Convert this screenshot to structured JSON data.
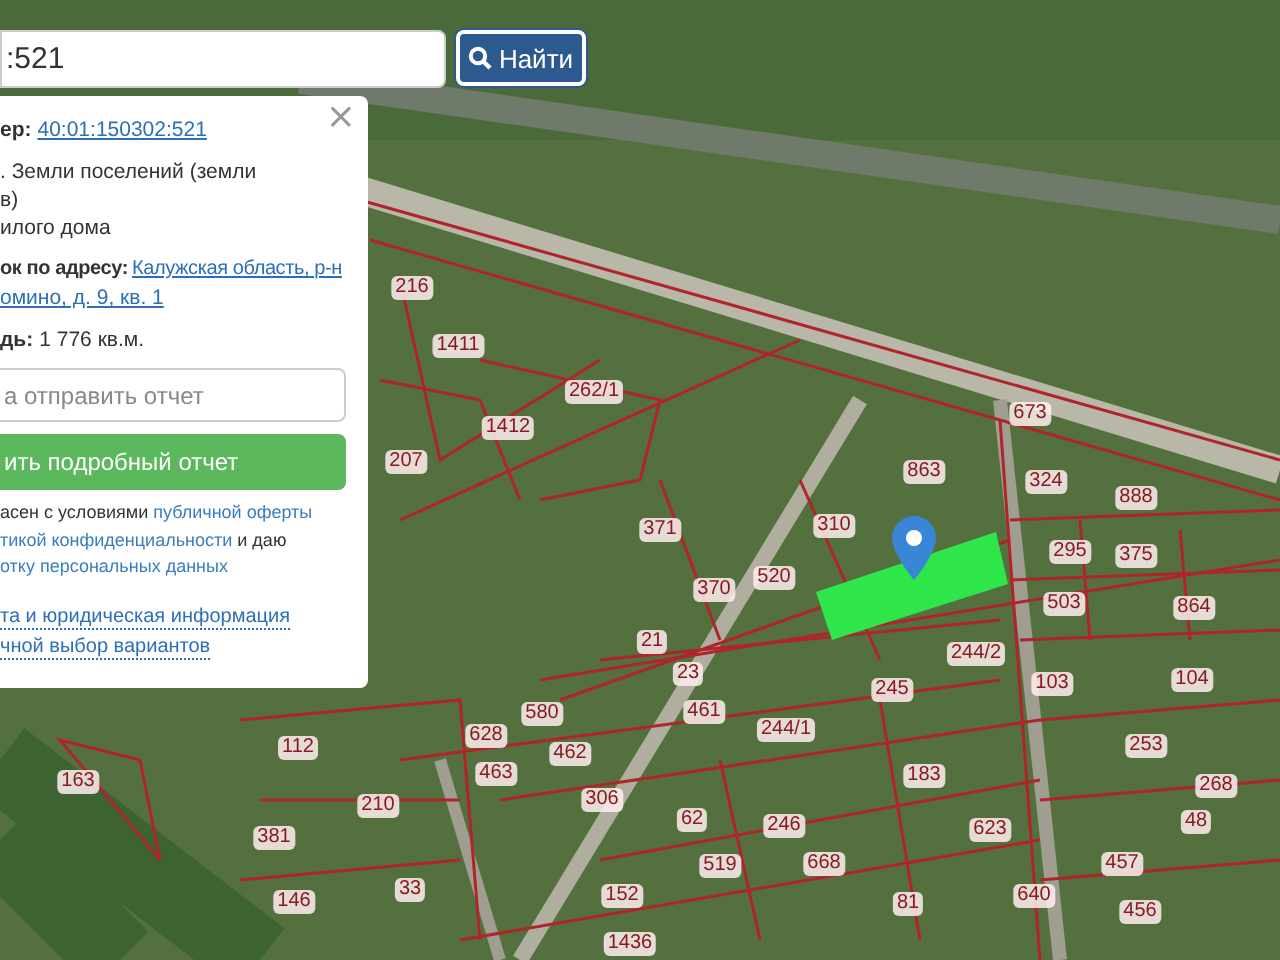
{
  "search": {
    "value": ":521",
    "button": "Найти"
  },
  "info_panel": {
    "close": "×",
    "cadastral": {
      "label": "ер:",
      "value": "40:01:150302:521"
    },
    "category_lines": [
      ". Земли поселений (земли",
      "в)",
      "илого дома"
    ],
    "address": {
      "label": "ок по адресу:",
      "lines": [
        "Калужская область, р-н",
        "омино, д. 9, кв. 1"
      ]
    },
    "area": {
      "label": "дь:",
      "value": "1 776 кв.м."
    },
    "email_field": {
      "placeholder": "а отправить отчет"
    },
    "report_button": "ить подробный отчет",
    "consent_lines": [
      [
        {
          "text": "асен с условиями ",
          "link": false
        },
        {
          "text": "публичной оферты",
          "link": true
        }
      ],
      [
        {
          "text": "тикой конфиденциальности",
          "link": true
        },
        {
          "text": " и даю",
          "link": false
        }
      ],
      [
        {
          "text": "отку персональных данных",
          "link": true
        }
      ]
    ],
    "footer_links": [
      "та и юридическая информация",
      "чной выбор вариантов"
    ]
  },
  "map": {
    "parcels": [
      {
        "number": "216"
      },
      {
        "number": "1411"
      },
      {
        "number": "262/1"
      },
      {
        "number": "1412"
      },
      {
        "number": "207"
      },
      {
        "number": "371"
      },
      {
        "number": "310"
      },
      {
        "number": "863"
      },
      {
        "number": "673"
      },
      {
        "number": "324"
      },
      {
        "number": "888"
      },
      {
        "number": "295"
      },
      {
        "number": "375"
      },
      {
        "number": "503"
      },
      {
        "number": "864"
      },
      {
        "number": "370"
      },
      {
        "number": "520"
      },
      {
        "number": "21"
      },
      {
        "number": "23"
      },
      {
        "number": "245"
      },
      {
        "number": "244/2"
      },
      {
        "number": "103"
      },
      {
        "number": "104"
      },
      {
        "number": "461"
      },
      {
        "number": "244/1"
      },
      {
        "number": "580"
      },
      {
        "number": "628"
      },
      {
        "number": "462"
      },
      {
        "number": "463"
      },
      {
        "number": "306"
      },
      {
        "number": "62"
      },
      {
        "number": "246"
      },
      {
        "number": "183"
      },
      {
        "number": "623"
      },
      {
        "number": "268"
      },
      {
        "number": "253"
      },
      {
        "number": "48"
      },
      {
        "number": "112"
      },
      {
        "number": "163"
      },
      {
        "number": "210"
      },
      {
        "number": "381"
      },
      {
        "number": "146"
      },
      {
        "number": "33"
      },
      {
        "number": "519"
      },
      {
        "number": "668"
      },
      {
        "number": "457"
      },
      {
        "number": "456"
      },
      {
        "number": "152"
      },
      {
        "number": "81"
      },
      {
        "number": "640"
      },
      {
        "number": "1436"
      }
    ]
  }
}
